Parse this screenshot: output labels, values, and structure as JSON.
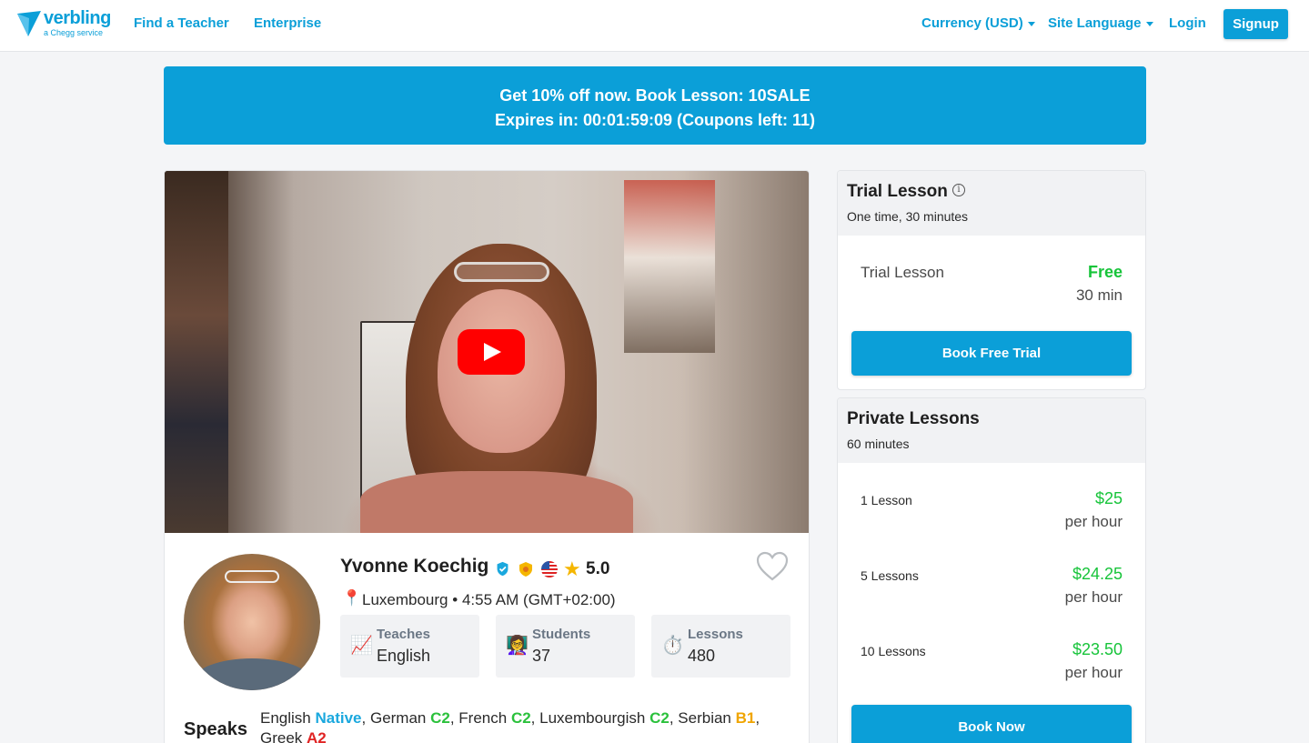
{
  "nav": {
    "logo_word": "verbling",
    "logo_sub": "a Chegg service",
    "find_teacher": "Find a Teacher",
    "enterprise": "Enterprise",
    "currency": "Currency (USD)",
    "site_language": "Site Language",
    "login": "Login",
    "signup": "Signup",
    "accent_color": "#0b9fd8"
  },
  "promo": {
    "line1": "Get 10% off now. Book Lesson: 10SALE",
    "line2": "Expires in: 00:01:59:09 (Coupons left: 11)"
  },
  "video": {
    "play_icon": "youtube-play-icon"
  },
  "teacher": {
    "name": "Yvonne Koechig",
    "rating": "5.0",
    "location": "Luxembourg",
    "separator": "•",
    "time": "4:55 AM (GMT+02:00)",
    "icons": [
      "verified-badge-icon",
      "pro-badge-icon",
      "us-flag-icon",
      "star-icon",
      "heart-icon",
      "location-pin-icon"
    ],
    "stats": [
      {
        "label": "Teaches",
        "value": "English",
        "icon": "📈"
      },
      {
        "label": "Students",
        "value": "37",
        "icon": "👩‍🏫"
      },
      {
        "label": "Lessons",
        "value": "480",
        "icon": "⏱️"
      }
    ],
    "speaks_heading": "Speaks",
    "speaks": [
      {
        "lang": "English",
        "level": "Native",
        "color": "#1aa8de"
      },
      {
        "lang": "German",
        "level": "C2",
        "color": "#2bc13c"
      },
      {
        "lang": "French",
        "level": "C2",
        "color": "#2bc13c"
      },
      {
        "lang": "Luxembourgish",
        "level": "C2",
        "color": "#2bc13c"
      },
      {
        "lang": "Serbian",
        "level": "B1",
        "color": "#f0a500"
      },
      {
        "lang": "Greek",
        "level": "A2",
        "color": "#e02424"
      }
    ]
  },
  "trial": {
    "title": "Trial Lesson",
    "subtitle": "One time, 30 minutes",
    "row_label": "Trial Lesson",
    "price": "Free",
    "duration": "30 min",
    "button": "Book Free Trial"
  },
  "private": {
    "title": "Private Lessons",
    "subtitle": "60 minutes",
    "rows": [
      {
        "label": "1 Lesson",
        "price": "$25",
        "unit": "per hour"
      },
      {
        "label": "5 Lessons",
        "price": "$24.25",
        "unit": "per hour"
      },
      {
        "label": "10 Lessons",
        "price": "$23.50",
        "unit": "per hour"
      }
    ],
    "button": "Book Now"
  }
}
